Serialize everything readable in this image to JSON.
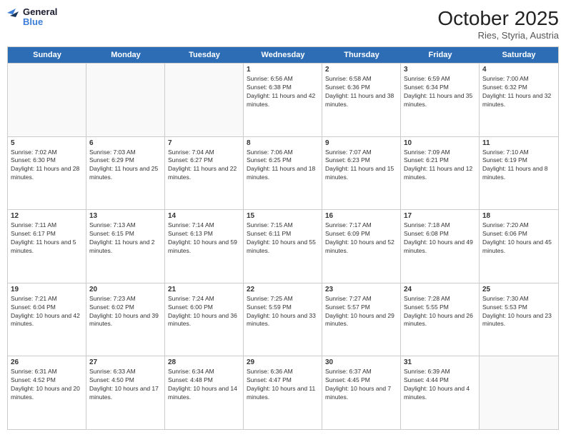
{
  "header": {
    "logo_line1": "General",
    "logo_line2": "Blue",
    "month": "October 2025",
    "location": "Ries, Styria, Austria"
  },
  "days_of_week": [
    "Sunday",
    "Monday",
    "Tuesday",
    "Wednesday",
    "Thursday",
    "Friday",
    "Saturday"
  ],
  "weeks": [
    [
      {
        "day": "",
        "info": ""
      },
      {
        "day": "",
        "info": ""
      },
      {
        "day": "",
        "info": ""
      },
      {
        "day": "1",
        "info": "Sunrise: 6:56 AM\nSunset: 6:38 PM\nDaylight: 11 hours and 42 minutes."
      },
      {
        "day": "2",
        "info": "Sunrise: 6:58 AM\nSunset: 6:36 PM\nDaylight: 11 hours and 38 minutes."
      },
      {
        "day": "3",
        "info": "Sunrise: 6:59 AM\nSunset: 6:34 PM\nDaylight: 11 hours and 35 minutes."
      },
      {
        "day": "4",
        "info": "Sunrise: 7:00 AM\nSunset: 6:32 PM\nDaylight: 11 hours and 32 minutes."
      }
    ],
    [
      {
        "day": "5",
        "info": "Sunrise: 7:02 AM\nSunset: 6:30 PM\nDaylight: 11 hours and 28 minutes."
      },
      {
        "day": "6",
        "info": "Sunrise: 7:03 AM\nSunset: 6:29 PM\nDaylight: 11 hours and 25 minutes."
      },
      {
        "day": "7",
        "info": "Sunrise: 7:04 AM\nSunset: 6:27 PM\nDaylight: 11 hours and 22 minutes."
      },
      {
        "day": "8",
        "info": "Sunrise: 7:06 AM\nSunset: 6:25 PM\nDaylight: 11 hours and 18 minutes."
      },
      {
        "day": "9",
        "info": "Sunrise: 7:07 AM\nSunset: 6:23 PM\nDaylight: 11 hours and 15 minutes."
      },
      {
        "day": "10",
        "info": "Sunrise: 7:09 AM\nSunset: 6:21 PM\nDaylight: 11 hours and 12 minutes."
      },
      {
        "day": "11",
        "info": "Sunrise: 7:10 AM\nSunset: 6:19 PM\nDaylight: 11 hours and 8 minutes."
      }
    ],
    [
      {
        "day": "12",
        "info": "Sunrise: 7:11 AM\nSunset: 6:17 PM\nDaylight: 11 hours and 5 minutes."
      },
      {
        "day": "13",
        "info": "Sunrise: 7:13 AM\nSunset: 6:15 PM\nDaylight: 11 hours and 2 minutes."
      },
      {
        "day": "14",
        "info": "Sunrise: 7:14 AM\nSunset: 6:13 PM\nDaylight: 10 hours and 59 minutes."
      },
      {
        "day": "15",
        "info": "Sunrise: 7:15 AM\nSunset: 6:11 PM\nDaylight: 10 hours and 55 minutes."
      },
      {
        "day": "16",
        "info": "Sunrise: 7:17 AM\nSunset: 6:09 PM\nDaylight: 10 hours and 52 minutes."
      },
      {
        "day": "17",
        "info": "Sunrise: 7:18 AM\nSunset: 6:08 PM\nDaylight: 10 hours and 49 minutes."
      },
      {
        "day": "18",
        "info": "Sunrise: 7:20 AM\nSunset: 6:06 PM\nDaylight: 10 hours and 45 minutes."
      }
    ],
    [
      {
        "day": "19",
        "info": "Sunrise: 7:21 AM\nSunset: 6:04 PM\nDaylight: 10 hours and 42 minutes."
      },
      {
        "day": "20",
        "info": "Sunrise: 7:23 AM\nSunset: 6:02 PM\nDaylight: 10 hours and 39 minutes."
      },
      {
        "day": "21",
        "info": "Sunrise: 7:24 AM\nSunset: 6:00 PM\nDaylight: 10 hours and 36 minutes."
      },
      {
        "day": "22",
        "info": "Sunrise: 7:25 AM\nSunset: 5:59 PM\nDaylight: 10 hours and 33 minutes."
      },
      {
        "day": "23",
        "info": "Sunrise: 7:27 AM\nSunset: 5:57 PM\nDaylight: 10 hours and 29 minutes."
      },
      {
        "day": "24",
        "info": "Sunrise: 7:28 AM\nSunset: 5:55 PM\nDaylight: 10 hours and 26 minutes."
      },
      {
        "day": "25",
        "info": "Sunrise: 7:30 AM\nSunset: 5:53 PM\nDaylight: 10 hours and 23 minutes."
      }
    ],
    [
      {
        "day": "26",
        "info": "Sunrise: 6:31 AM\nSunset: 4:52 PM\nDaylight: 10 hours and 20 minutes."
      },
      {
        "day": "27",
        "info": "Sunrise: 6:33 AM\nSunset: 4:50 PM\nDaylight: 10 hours and 17 minutes."
      },
      {
        "day": "28",
        "info": "Sunrise: 6:34 AM\nSunset: 4:48 PM\nDaylight: 10 hours and 14 minutes."
      },
      {
        "day": "29",
        "info": "Sunrise: 6:36 AM\nSunset: 4:47 PM\nDaylight: 10 hours and 11 minutes."
      },
      {
        "day": "30",
        "info": "Sunrise: 6:37 AM\nSunset: 4:45 PM\nDaylight: 10 hours and 7 minutes."
      },
      {
        "day": "31",
        "info": "Sunrise: 6:39 AM\nSunset: 4:44 PM\nDaylight: 10 hours and 4 minutes."
      },
      {
        "day": "",
        "info": ""
      }
    ]
  ]
}
